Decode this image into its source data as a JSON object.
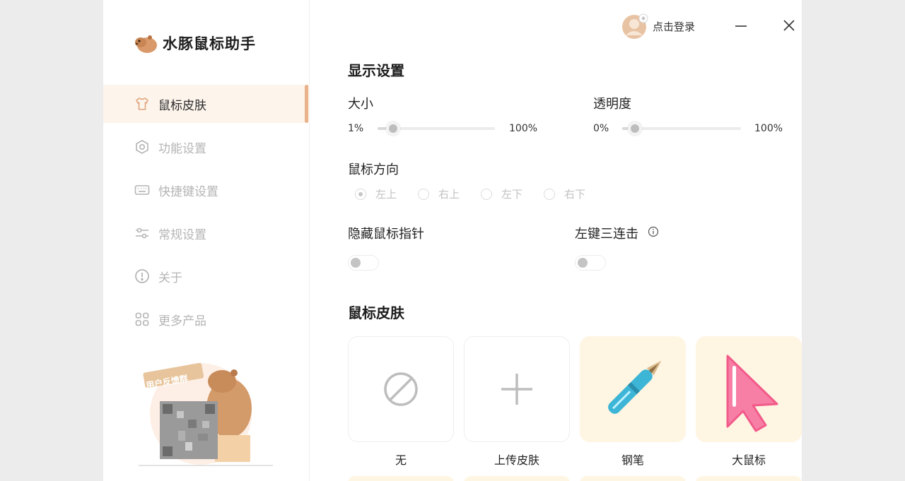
{
  "app": {
    "name": "水豚鼠标助手"
  },
  "header": {
    "login_text": "点击登录"
  },
  "sidebar": {
    "items": [
      {
        "label": "鼠标皮肤",
        "icon": "shirt-icon",
        "active": true
      },
      {
        "label": "功能设置",
        "icon": "hexagon-gear-icon",
        "active": false
      },
      {
        "label": "快捷键设置",
        "icon": "keyboard-icon",
        "active": false
      },
      {
        "label": "常规设置",
        "icon": "sliders-icon",
        "active": false
      },
      {
        "label": "关于",
        "icon": "exclamation-circle-icon",
        "active": false
      },
      {
        "label": "更多产品",
        "icon": "grid-icon",
        "active": false
      }
    ],
    "feedback": {
      "label": "用户反馈群"
    }
  },
  "display": {
    "title": "显示设置",
    "size": {
      "label": "大小",
      "min": "1%",
      "max": "100%",
      "value_percent": 13
    },
    "opacity": {
      "label": "透明度",
      "min": "0%",
      "max": "100%",
      "value_percent": 11
    },
    "direction": {
      "label": "鼠标方向",
      "options": [
        "左上",
        "右上",
        "左下",
        "右下"
      ],
      "selected": "左上"
    },
    "hide_pointer": {
      "label": "隐藏鼠标指针",
      "on": false
    },
    "triple_click": {
      "label": "左键三连击",
      "on": false
    }
  },
  "skins": {
    "title": "鼠标皮肤",
    "items": [
      {
        "label": "无",
        "icon": "prohibit-icon"
      },
      {
        "label": "上传皮肤",
        "icon": "plus-icon"
      },
      {
        "label": "钢笔",
        "icon": "fountain-pen-icon"
      },
      {
        "label": "大鼠标",
        "icon": "pink-cursor-icon"
      }
    ]
  },
  "colors": {
    "accent": "#e9b28a",
    "active_bg": "#fdf4ec",
    "card_tint": "#fff5e3",
    "pen_blue": "#3cb5d6",
    "cursor_pink": "#f77fa6"
  }
}
